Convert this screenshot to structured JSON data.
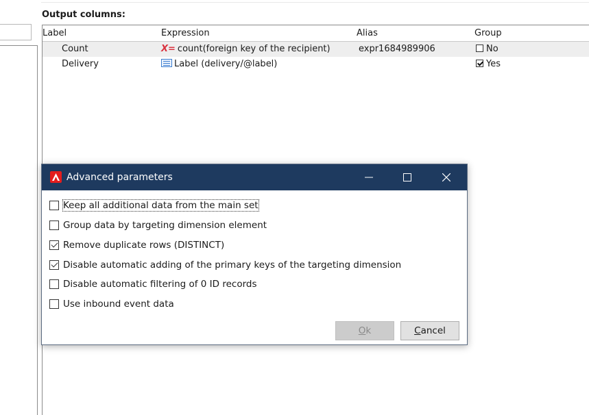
{
  "section": {
    "title": "Output columns:"
  },
  "grid": {
    "headers": [
      "Label",
      "Expression",
      "Alias",
      "Group"
    ],
    "rows": [
      {
        "label": "Count",
        "expression_icon": "x-formula-icon",
        "expression": "count(foreign key of the recipient)",
        "alias": "expr1684989906",
        "group_checked": false,
        "group_text": "No"
      },
      {
        "label": "Delivery",
        "expression_icon": "list-field-icon",
        "expression": "Label (delivery/@label)",
        "alias": "",
        "group_checked": true,
        "group_text": "Yes"
      }
    ],
    "x_icon_text": "X="
  },
  "dialog": {
    "title": "Advanced parameters",
    "options": [
      {
        "label": "Keep all additional data from the main set",
        "checked": false
      },
      {
        "label": "Group data by targeting dimension element",
        "checked": false
      },
      {
        "label": "Remove duplicate rows (DISTINCT)",
        "checked": true
      },
      {
        "label": "Disable automatic adding of the primary keys of the targeting dimension",
        "checked": true
      },
      {
        "label": "Disable automatic filtering of 0 ID records",
        "checked": false
      },
      {
        "label": "Use inbound event data",
        "checked": false
      }
    ],
    "ok_label": "Ok",
    "cancel_label": "Cancel"
  },
  "colors": {
    "titlebar": "#1e3a5f",
    "brand": "#e41d1d",
    "formula": "#d9323f"
  }
}
